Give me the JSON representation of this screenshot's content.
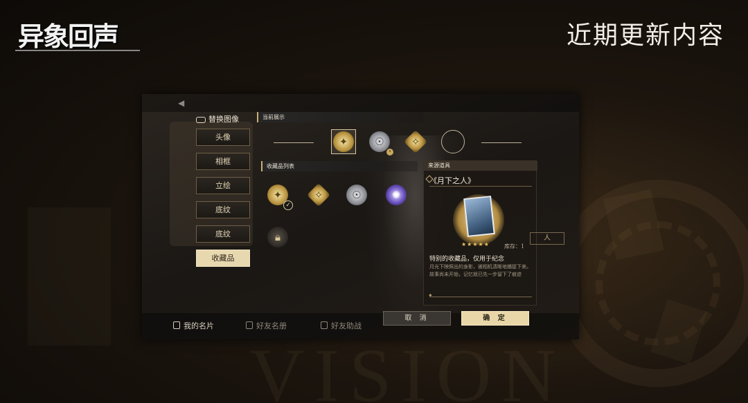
{
  "header": {
    "logo_text": "异象回声",
    "title": "近期更新内容"
  },
  "background": {
    "watermark": "VISION"
  },
  "menu": {
    "title": "替换图像",
    "items": [
      {
        "label": "头像",
        "active": false
      },
      {
        "label": "相框",
        "active": false
      },
      {
        "label": "立绘",
        "active": false
      },
      {
        "label": "底纹",
        "active": false
      },
      {
        "label": "底纹",
        "active": false
      },
      {
        "label": "收藏品",
        "active": true
      }
    ]
  },
  "current_display": {
    "header": "当前展示",
    "slots": [
      {
        "icon": "gold-crest-icon",
        "selected": true
      },
      {
        "icon": "silver-mask-icon",
        "selected": false
      },
      {
        "icon": "gold-diamond-icon",
        "selected": false
      },
      {
        "icon": "empty-slot-icon",
        "selected": false
      }
    ]
  },
  "collection_list": {
    "header": "收藏品列表",
    "items": [
      {
        "icon": "gold-crest-icon",
        "equipped": true,
        "locked": false
      },
      {
        "icon": "gold-diamond-icon",
        "equipped": false,
        "locked": false
      },
      {
        "icon": "silver-mask-icon",
        "equipped": false,
        "locked": false
      },
      {
        "icon": "purple-flower-icon",
        "equipped": false,
        "locked": false
      },
      {
        "icon": "lock-icon",
        "equipped": false,
        "locked": true
      }
    ]
  },
  "detail": {
    "header": "来源道具",
    "name": "《月下之人》",
    "stars": "★★★★★",
    "stock": "库存：1",
    "desc_title": "特别的收藏品，仅用于纪念",
    "desc_body": "月光下映照出的身影，被相机清晰地捕捉下来。故事尚未开始，记忆就已先一步留下了痕迹"
  },
  "buttons": {
    "cancel": "取 消",
    "confirm": "确 定"
  },
  "bottom_tabs": [
    {
      "label": "我的名片",
      "active": true
    },
    {
      "label": "好友名册",
      "active": false
    },
    {
      "label": "好友助战",
      "active": false
    }
  ],
  "colors": {
    "accent_gold": "#e8d6a8",
    "panel_dark": "#1c1915",
    "border_gold": "#6f5f45"
  }
}
